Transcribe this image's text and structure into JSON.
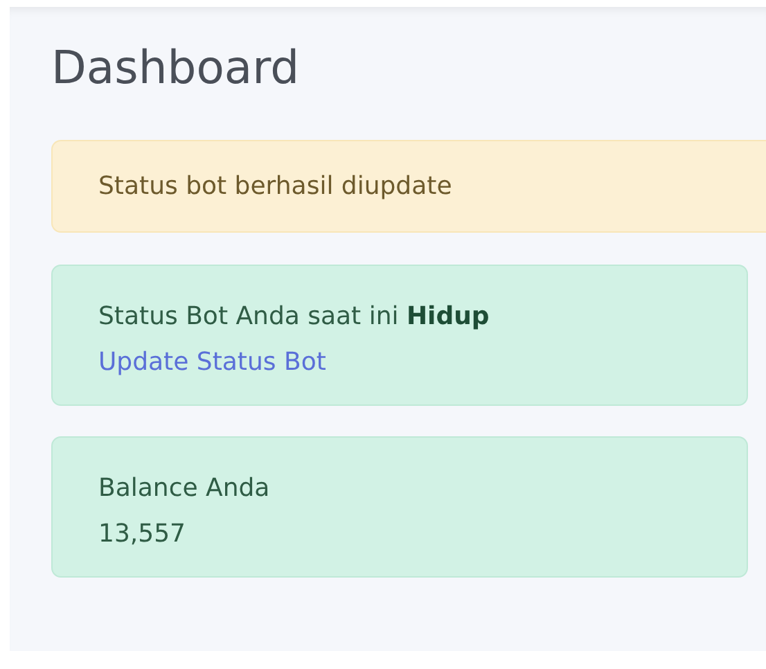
{
  "page_title": "Dashboard",
  "alert": {
    "kind": "warning",
    "text": "Status bot berhasil diupdate"
  },
  "cards": [
    {
      "kind": "status",
      "text": "Status Bot Anda saat ini **Hidup**",
      "link": "Update Status Bot"
    },
    {
      "kind": "balance",
      "label": "Balance Anda",
      "value": "13,557"
    }
  ]
}
